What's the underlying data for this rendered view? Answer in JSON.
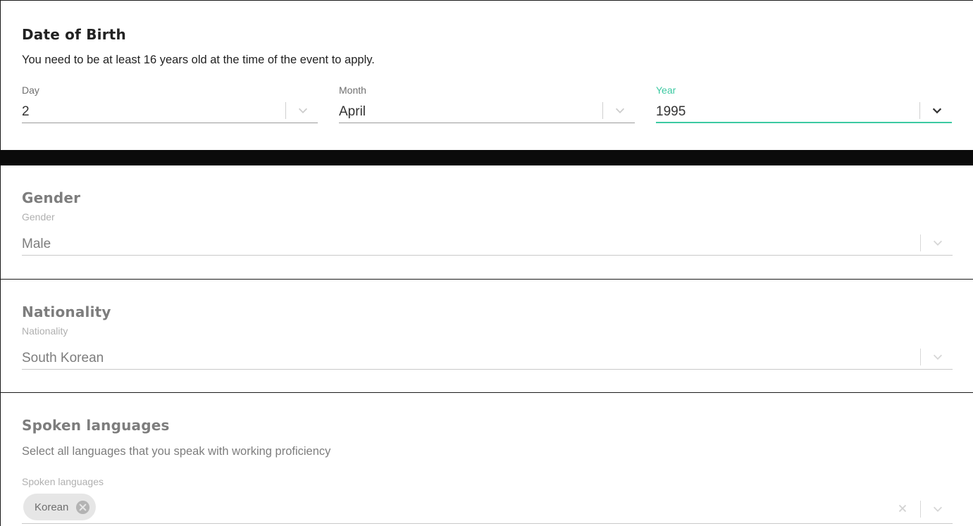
{
  "date_of_birth": {
    "title": "Date of Birth",
    "description": "You need to be at least 16 years old at the time of the event to apply.",
    "day": {
      "label": "Day",
      "value": "2"
    },
    "month": {
      "label": "Month",
      "value": "April"
    },
    "year": {
      "label": "Year",
      "value": "1995"
    }
  },
  "gender": {
    "title": "Gender",
    "label": "Gender",
    "value": "Male"
  },
  "nationality": {
    "title": "Nationality",
    "label": "Nationality",
    "value": "South Korean"
  },
  "spoken_languages": {
    "title": "Spoken languages",
    "description": "Select all languages that you speak with working proficiency",
    "label": "Spoken languages",
    "selected": [
      {
        "label": "Korean"
      }
    ]
  },
  "colors": {
    "focus_accent": "#3cc9a2",
    "active_text": "#222222",
    "disabled_text": "#7d7d7d"
  },
  "icons": [
    "chevron-down-icon",
    "clear-icon",
    "remove-chip-icon"
  ]
}
